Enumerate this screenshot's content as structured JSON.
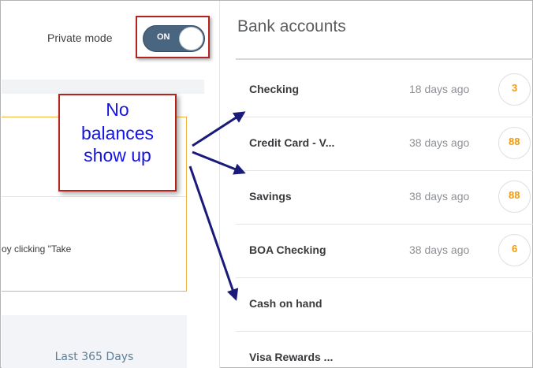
{
  "header": {
    "private_mode_label": "Private mode",
    "toggle_state": "ON"
  },
  "annotation": {
    "line1": "No",
    "line2": "balances",
    "line3": "show up"
  },
  "left_panel": {
    "take_text": "oy clicking \"Take",
    "date_filter": "Last 365 Days"
  },
  "bank_accounts": {
    "title": "Bank accounts",
    "accounts": [
      {
        "name": "Checking",
        "updated": "18 days ago",
        "badge": "3"
      },
      {
        "name": "Credit Card - V...",
        "updated": "38 days ago",
        "badge": "88"
      },
      {
        "name": "Savings",
        "updated": "38 days ago",
        "badge": "88"
      },
      {
        "name": "BOA Checking",
        "updated": "38 days ago",
        "badge": "6"
      },
      {
        "name": "Cash on hand",
        "updated": "",
        "badge": ""
      },
      {
        "name": "Visa Rewards ...",
        "updated": "",
        "badge": ""
      }
    ]
  },
  "colors": {
    "toggle_bg": "#4a6580",
    "callout_red": "#b5231f",
    "note_text": "#1414e6",
    "badge_orange": "#f29a0b",
    "arrow_navy": "#1a1a7a",
    "card_border": "#f0b540"
  }
}
